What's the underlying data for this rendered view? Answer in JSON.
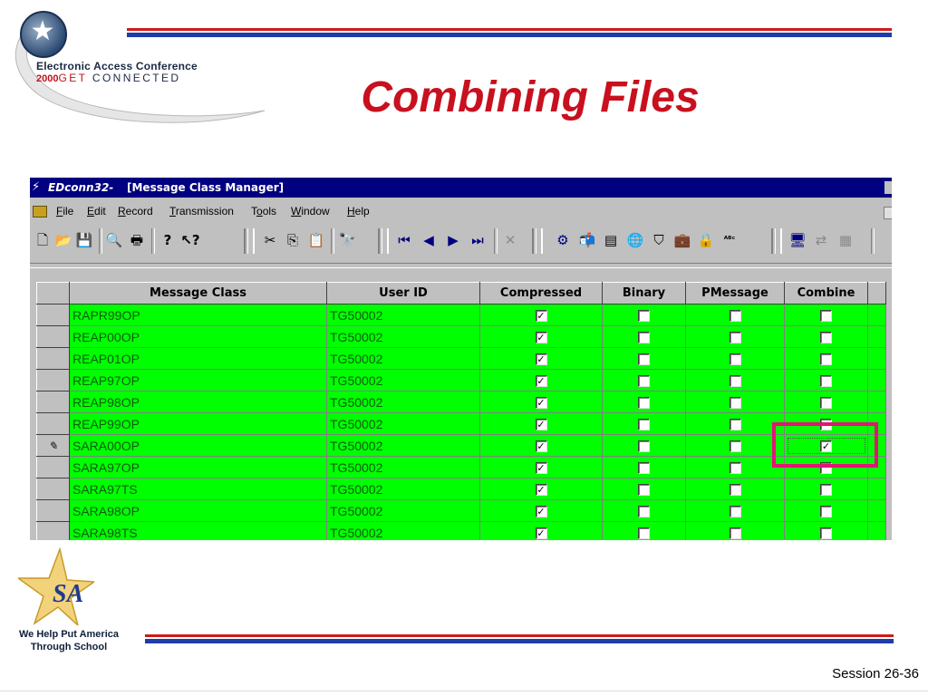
{
  "slide": {
    "title": "Combining Files",
    "conference": {
      "line1": "Electronic Access Conference",
      "year": "2000",
      "get": "GET",
      "connected": "CONNECTED"
    },
    "tagline_line1": "We Help Put America",
    "tagline_line2": "Through School",
    "session": "Session 26-36",
    "colors": {
      "title": "#c8101e",
      "stripe_red": "#d11a1a",
      "stripe_blue": "#1d3da8",
      "highlight": "#e41477",
      "row_green": "#00ff00"
    }
  },
  "window": {
    "app_name": "EDconn32-",
    "doc_title": "[Message Class Manager]",
    "menu": [
      {
        "label": "File",
        "mnemonic": "F"
      },
      {
        "label": "Edit",
        "mnemonic": "E"
      },
      {
        "label": "Record",
        "mnemonic": "R"
      },
      {
        "label": "Transmission",
        "mnemonic": "T"
      },
      {
        "label": "Tools",
        "mnemonic": "o"
      },
      {
        "label": "Window",
        "mnemonic": "W"
      },
      {
        "label": "Help",
        "mnemonic": "H"
      }
    ],
    "toolbar_icons": [
      "new-icon",
      "open-icon",
      "save-icon",
      "print-preview-icon",
      "print-icon",
      "help-icon",
      "context-help-icon",
      "cut-icon",
      "copy-icon",
      "paste-icon",
      "find-icon",
      "first-record-icon",
      "prev-record-icon",
      "next-record-icon",
      "last-record-icon",
      "delete-icon",
      "tools-icon",
      "mailbox-icon",
      "table-icon",
      "globe-icon",
      "shield-icon",
      "briefcase-icon",
      "lock-icon",
      "spellcheck-icon",
      "computer-icon",
      "network-icon",
      "terminal-icon"
    ]
  },
  "grid": {
    "columns": [
      "Message Class",
      "User ID",
      "Compressed",
      "Binary",
      "PMessage",
      "Combine"
    ],
    "current_row_marker": "✎",
    "rows": [
      {
        "message_class": "RAPR99OP",
        "user_id": "TG50002",
        "compressed": true,
        "binary": false,
        "pmessage": false,
        "combine": false,
        "current": false
      },
      {
        "message_class": "REAP00OP",
        "user_id": "TG50002",
        "compressed": true,
        "binary": false,
        "pmessage": false,
        "combine": false,
        "current": false
      },
      {
        "message_class": "REAP01OP",
        "user_id": "TG50002",
        "compressed": true,
        "binary": false,
        "pmessage": false,
        "combine": false,
        "current": false
      },
      {
        "message_class": "REAP97OP",
        "user_id": "TG50002",
        "compressed": true,
        "binary": false,
        "pmessage": false,
        "combine": false,
        "current": false
      },
      {
        "message_class": "REAP98OP",
        "user_id": "TG50002",
        "compressed": true,
        "binary": false,
        "pmessage": false,
        "combine": false,
        "current": false
      },
      {
        "message_class": "REAP99OP",
        "user_id": "TG50002",
        "compressed": true,
        "binary": false,
        "pmessage": false,
        "combine": false,
        "current": false
      },
      {
        "message_class": "SARA00OP",
        "user_id": "TG50002",
        "compressed": true,
        "binary": false,
        "pmessage": false,
        "combine": true,
        "current": true
      },
      {
        "message_class": "SARA97OP",
        "user_id": "TG50002",
        "compressed": true,
        "binary": false,
        "pmessage": false,
        "combine": false,
        "current": false
      },
      {
        "message_class": "SARA97TS",
        "user_id": "TG50002",
        "compressed": true,
        "binary": false,
        "pmessage": false,
        "combine": false,
        "current": false
      },
      {
        "message_class": "SARA98OP",
        "user_id": "TG50002",
        "compressed": true,
        "binary": false,
        "pmessage": false,
        "combine": false,
        "current": false
      },
      {
        "message_class": "SARA98TS",
        "user_id": "TG50002",
        "compressed": true,
        "binary": false,
        "pmessage": false,
        "combine": false,
        "current": false
      }
    ]
  }
}
